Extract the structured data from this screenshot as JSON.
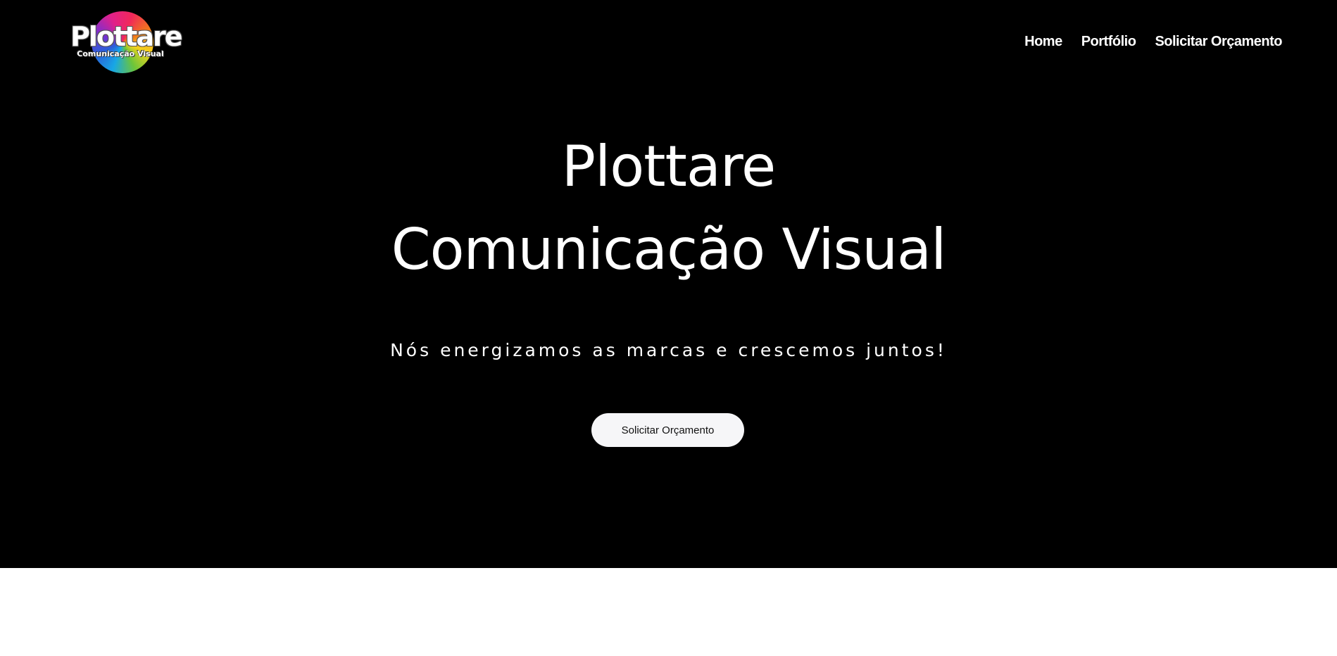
{
  "brand": {
    "logo_word": "Plottare",
    "logo_sub": "Comunicação Visual",
    "logo_icon": "color-wheel-logo"
  },
  "nav": {
    "items": [
      "Home",
      "Portfólio",
      "Solicitar Orçamento"
    ]
  },
  "hero": {
    "title_line1": "Plottare",
    "title_line2": "Comunicação Visual",
    "tagline": "Nós energizamos as marcas e crescemos juntos!",
    "cta_label": "Solicitar Orçamento"
  },
  "colors": {
    "hero_background": "#000000",
    "text": "#ffffff",
    "button_background": "#f6f6f8",
    "page_background": "#ffffff"
  }
}
